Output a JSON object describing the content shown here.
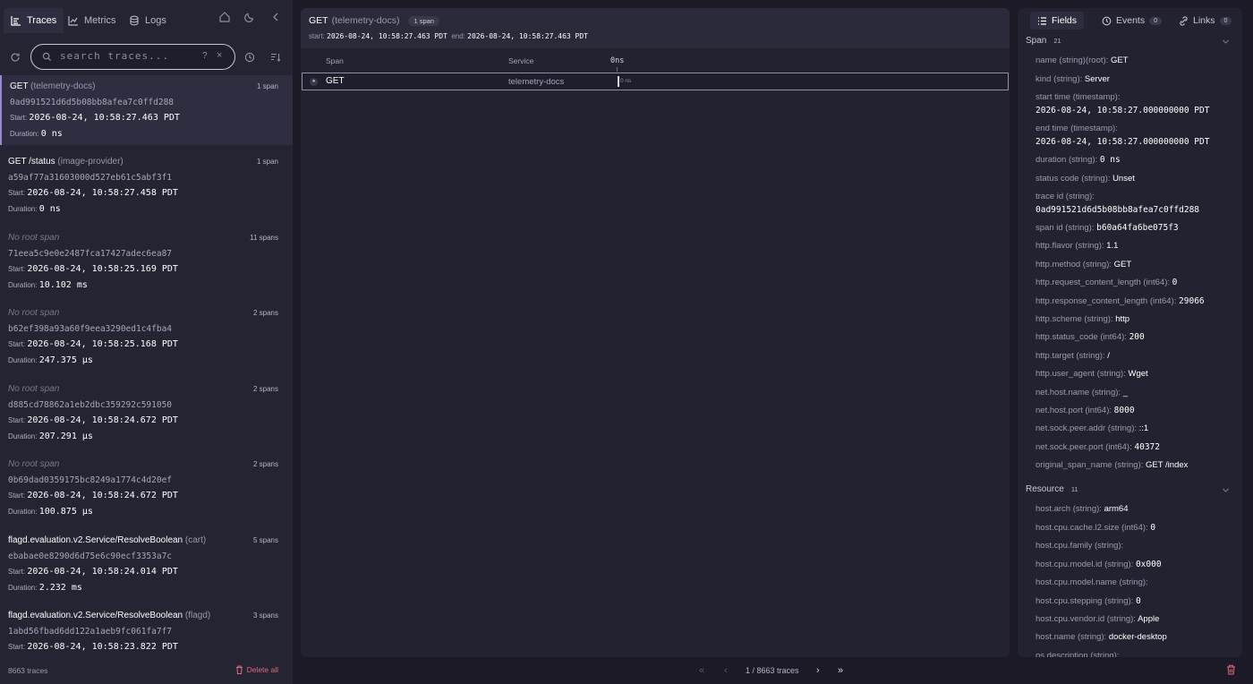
{
  "nav": {
    "tabs": [
      {
        "label": "Traces",
        "icon": "traces-icon",
        "active": true
      },
      {
        "label": "Metrics",
        "icon": "metrics-icon",
        "active": false
      },
      {
        "label": "Logs",
        "icon": "logs-icon",
        "active": false
      }
    ]
  },
  "search": {
    "placeholder": "search traces...",
    "help": "?",
    "clear": "×"
  },
  "traces": [
    {
      "name": "GET",
      "service": "(telemetry-docs)",
      "root": true,
      "spans": "1 span",
      "id": "0ad991521d6d5b08bb8afea7c0ffd288",
      "start_label": "Start:",
      "start": "2026-08-24, 10:58:27.463 PDT",
      "dur_label": "Duration:",
      "duration": "0 ns",
      "selected": true
    },
    {
      "name": "GET /status",
      "service": "(image-provider)",
      "root": true,
      "spans": "1 span",
      "id": "a59af77a31603000d527eb61c5abf3f1",
      "start_label": "Start:",
      "start": "2026-08-24, 10:58:27.458 PDT",
      "dur_label": "Duration:",
      "duration": "0 ns"
    },
    {
      "name": "No root span",
      "service": "",
      "root": false,
      "spans": "11 spans",
      "id": "71eea5c9e0e2487fca17427adec6ea87",
      "start_label": "Start:",
      "start": "2026-08-24, 10:58:25.169 PDT",
      "dur_label": "Duration:",
      "duration": "10.102 ms"
    },
    {
      "name": "No root span",
      "service": "",
      "root": false,
      "spans": "2 spans",
      "id": "b62ef398a93a60f9eea3290ed1c4fba4",
      "start_label": "Start:",
      "start": "2026-08-24, 10:58:25.168 PDT",
      "dur_label": "Duration:",
      "duration": "247.375 µs"
    },
    {
      "name": "No root span",
      "service": "",
      "root": false,
      "spans": "2 spans",
      "id": "d885cd78862a1eb2dbc359292c591050",
      "start_label": "Start:",
      "start": "2026-08-24, 10:58:24.672 PDT",
      "dur_label": "Duration:",
      "duration": "207.291 µs"
    },
    {
      "name": "No root span",
      "service": "",
      "root": false,
      "spans": "2 spans",
      "id": "0b69dad0359175bc8249a1774c4d20ef",
      "start_label": "Start:",
      "start": "2026-08-24, 10:58:24.672 PDT",
      "dur_label": "Duration:",
      "duration": "100.875 µs"
    },
    {
      "name": "flagd.evaluation.v2.Service/ResolveBoolean",
      "service": "(cart)",
      "root": true,
      "spans": "5 spans",
      "id": "ebabae0e8290d6d75e6c90ecf3353a7c",
      "start_label": "Start:",
      "start": "2026-08-24, 10:58:24.014 PDT",
      "dur_label": "Duration:",
      "duration": "2.232 ms"
    },
    {
      "name": "flagd.evaluation.v2.Service/ResolveBoolean",
      "service": "(flagd)",
      "root": true,
      "spans": "3 spans",
      "id": "1abd56fbad6dd122a1aeb9fc061fa7f7",
      "start_label": "Start:",
      "start": "2026-08-24, 10:58:23.822 PDT",
      "dur_label": "",
      "duration": ""
    }
  ],
  "footer": {
    "count": "8663 traces",
    "delete_all": "Delete all"
  },
  "detail": {
    "name": "GET",
    "service": "(telemetry-docs)",
    "spans": "1 span",
    "start_label": "start:",
    "start": "2026-08-24, 10:58:27.463 PDT",
    "end_label": "end:",
    "end": "2026-08-24, 10:58:27.463 PDT",
    "columns": {
      "span": "Span",
      "service": "Service",
      "timeline": "0ns"
    },
    "row": {
      "dot": "●",
      "name": "GET",
      "service": "telemetry-docs",
      "bar_label": "0 ns"
    }
  },
  "pager": {
    "first": "«",
    "prev": "‹",
    "info": "1 / 8663 traces",
    "next": "›",
    "last": "»"
  },
  "right": {
    "tabs": [
      {
        "label": "Fields",
        "count": "",
        "icon": "list-icon",
        "active": true
      },
      {
        "label": "Events",
        "count": "0",
        "icon": "clock-icon",
        "active": false
      },
      {
        "label": "Links",
        "count": "0",
        "icon": "link-icon",
        "active": false
      }
    ],
    "span_section": {
      "label": "Span",
      "count": "21"
    },
    "span_fields": [
      {
        "key": "name (string)(root):",
        "value": "GET",
        "mono": false,
        "wrap": false
      },
      {
        "key": "kind (string):",
        "value": "Server",
        "mono": false,
        "wrap": false
      },
      {
        "key": "start time (timestamp):",
        "value": "2026-08-24, 10:58:27.000000000 PDT",
        "mono": false,
        "wrap": true
      },
      {
        "key": "end time (timestamp):",
        "value": "2026-08-24, 10:58:27.000000000 PDT",
        "mono": false,
        "wrap": true
      },
      {
        "key": "duration (string):",
        "value": "0 ns",
        "mono": false,
        "wrap": false
      },
      {
        "key": "status code (string):",
        "value": "Unset",
        "mono": false,
        "wrap": false
      },
      {
        "key": "trace id (string):",
        "value": "0ad991521d6d5b08bb8afea7c0ffd288",
        "mono": false,
        "wrap": true
      },
      {
        "key": "span id (string):",
        "value": "b60a64fa6be075f3",
        "mono": false,
        "wrap": false
      },
      {
        "key": "http.flavor (string):",
        "value": "1.1",
        "mono": false,
        "wrap": false
      },
      {
        "key": "http.method (string):",
        "value": "GET",
        "mono": false,
        "wrap": false
      },
      {
        "key": "http.request_content_length (int64):",
        "value": "0",
        "mono": true,
        "wrap": false
      },
      {
        "key": "http.response_content_length (int64):",
        "value": "29066",
        "mono": true,
        "wrap": false
      },
      {
        "key": "http.scheme (string):",
        "value": "http",
        "mono": false,
        "wrap": false
      },
      {
        "key": "http.status_code (int64):",
        "value": "200",
        "mono": true,
        "wrap": false
      },
      {
        "key": "http.target (string):",
        "value": "/",
        "mono": false,
        "wrap": false
      },
      {
        "key": "http.user_agent (string):",
        "value": "Wget",
        "mono": false,
        "wrap": false
      },
      {
        "key": "net.host.name (string):",
        "value": "_",
        "mono": false,
        "wrap": false
      },
      {
        "key": "net.host.port (int64):",
        "value": "8000",
        "mono": true,
        "wrap": false
      },
      {
        "key": "net.sock.peer.addr (string):",
        "value": "::1",
        "mono": false,
        "wrap": false
      },
      {
        "key": "net.sock.peer.port (int64):",
        "value": "40372",
        "mono": true,
        "wrap": false
      },
      {
        "key": "original_span_name (string):",
        "value": "GET /index",
        "mono": false,
        "wrap": false
      }
    ],
    "resource_section": {
      "label": "Resource",
      "count": "11"
    },
    "resource_fields": [
      {
        "key": "host.arch (string):",
        "value": "arm64",
        "mono": false
      },
      {
        "key": "host.cpu.cache.l2.size (int64):",
        "value": "0",
        "mono": true
      },
      {
        "key": "host.cpu.family (string):",
        "value": "",
        "mono": false
      },
      {
        "key": "host.cpu.model.id (string):",
        "value": "0x000",
        "mono": false
      },
      {
        "key": "host.cpu.model.name (string):",
        "value": "",
        "mono": false
      },
      {
        "key": "host.cpu.stepping (string):",
        "value": "0",
        "mono": false
      },
      {
        "key": "host.cpu.vendor.id (string):",
        "value": "Apple",
        "mono": false
      },
      {
        "key": "host.name (string):",
        "value": "docker-desktop",
        "mono": false
      },
      {
        "key": "os.description (string):",
        "value": "",
        "mono": false
      }
    ]
  },
  "colors": {
    "accent": "#9b87d6",
    "danger": "#e06a7b",
    "background": "#1b1a26",
    "panel": "#232231"
  }
}
